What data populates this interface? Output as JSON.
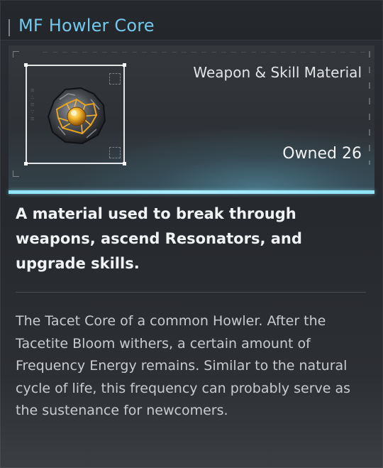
{
  "item": {
    "title": "MF Howler Core",
    "type": "Weapon & Skill Material",
    "owned": "Owned 26",
    "usage": "A material used to break through weapons, ascend Resonators, and upgrade skills.",
    "lore": "The Tacet Core of a common Howler. After the Tacetite Bloom withers, a certain amount of Frequency Energy remains. Similar to the natural cycle of life, this frequency can probably serve as the sustenance for newcomers."
  },
  "icons": {
    "item_icon": "howler-core-icon"
  },
  "colors": {
    "title": "#73c9ea",
    "accent_divider": "#a9ecfb",
    "core_gold": "#e9a21a"
  }
}
